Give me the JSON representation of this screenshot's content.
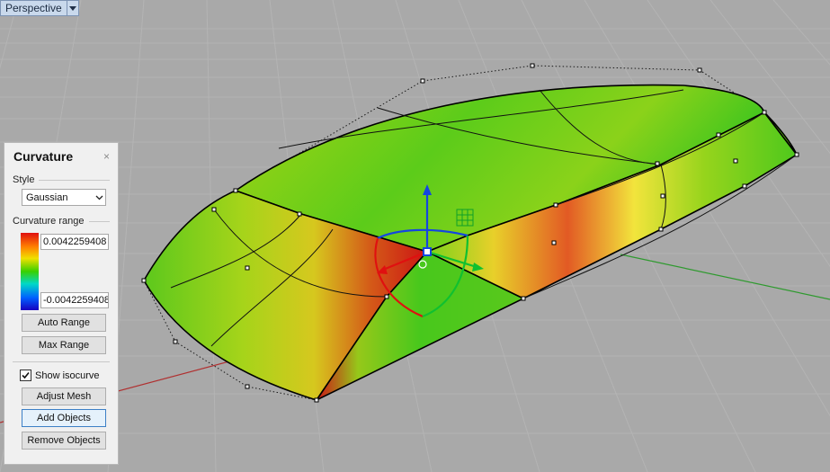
{
  "viewport": {
    "name": "Perspective",
    "colors": {
      "background": "#a9a9a9",
      "grid": "#b3b3b3",
      "x_axis": "#b03030",
      "y_axis": "#2f9a2f"
    }
  },
  "panel": {
    "title": "Curvature",
    "close_glyph": "×",
    "style_label": "Style",
    "style_value": "Gaussian",
    "range_label": "Curvature range",
    "max_value": "0.0042259408",
    "min_value": "-0.0042259408",
    "auto_range": "Auto Range",
    "max_range": "Max Range",
    "show_isocurve_label": "Show isocurve",
    "show_isocurve_checked": true,
    "adjust_mesh": "Adjust Mesh",
    "add_objects": "Add Objects",
    "remove_objects": "Remove Objects"
  },
  "icons": {
    "viewport_menu": "triangle-down-icon",
    "dropdown": "chevron-down-icon",
    "check": "check-icon",
    "close": "close-icon"
  }
}
